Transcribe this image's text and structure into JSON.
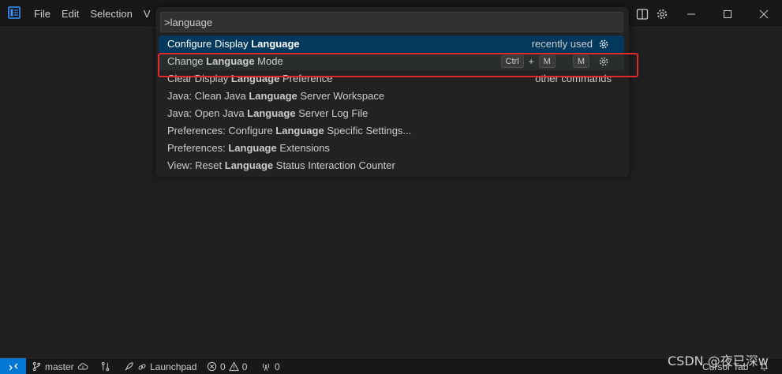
{
  "menu": {
    "items": [
      "File",
      "Edit",
      "Selection",
      "View"
    ]
  },
  "quick_pick": {
    "input_value": ">language",
    "items": [
      {
        "prefix": "Configure Display ",
        "match": "Language",
        "suffix": "",
        "description": "recently used",
        "gear": true,
        "state": "selected"
      },
      {
        "prefix": "Change ",
        "match": "Language",
        "suffix": " Mode",
        "keybinding": [
          "Ctrl",
          "M",
          "M"
        ],
        "gear": true,
        "state": "hover"
      },
      {
        "prefix": "Clear Display ",
        "match": "Language",
        "suffix": " Preference",
        "description": "other commands"
      },
      {
        "prefix": "Java: Clean Java ",
        "match": "Language",
        "suffix": " Server Workspace"
      },
      {
        "prefix": "Java: Open Java ",
        "match": "Language",
        "suffix": " Server Log File"
      },
      {
        "prefix": "Preferences: Configure ",
        "match": "Language",
        "suffix": " Specific Settings..."
      },
      {
        "prefix": "Preferences: ",
        "match": "Language",
        "suffix": " Extensions"
      },
      {
        "prefix": "View: Reset ",
        "match": "Language",
        "suffix": " Status Interaction Counter"
      }
    ],
    "keybinding_plus": "+"
  },
  "statusbar": {
    "branch": "master",
    "launchpad": "Launchpad",
    "errors": "0",
    "warnings": "0",
    "ports": "0",
    "cursor_tab": "Cursor Tab"
  },
  "watermark": "CSDN @夜已深w",
  "colors": {
    "accent": "#0078d4",
    "selected_row": "#04395e",
    "highlight_box": "#e02a2a"
  },
  "icons": {
    "app": "vscode-logo-icon",
    "layout": "toggle-panel-icon",
    "settings": "gear-icon",
    "minimize": "minimize-icon",
    "maximize": "maximize-icon",
    "close": "close-icon",
    "branch": "git-branch-icon",
    "sync": "cloud-sync-icon",
    "launchpad": "rocket-icon",
    "errors": "error-icon",
    "warnings": "warning-icon",
    "ports": "broadcast-icon"
  }
}
